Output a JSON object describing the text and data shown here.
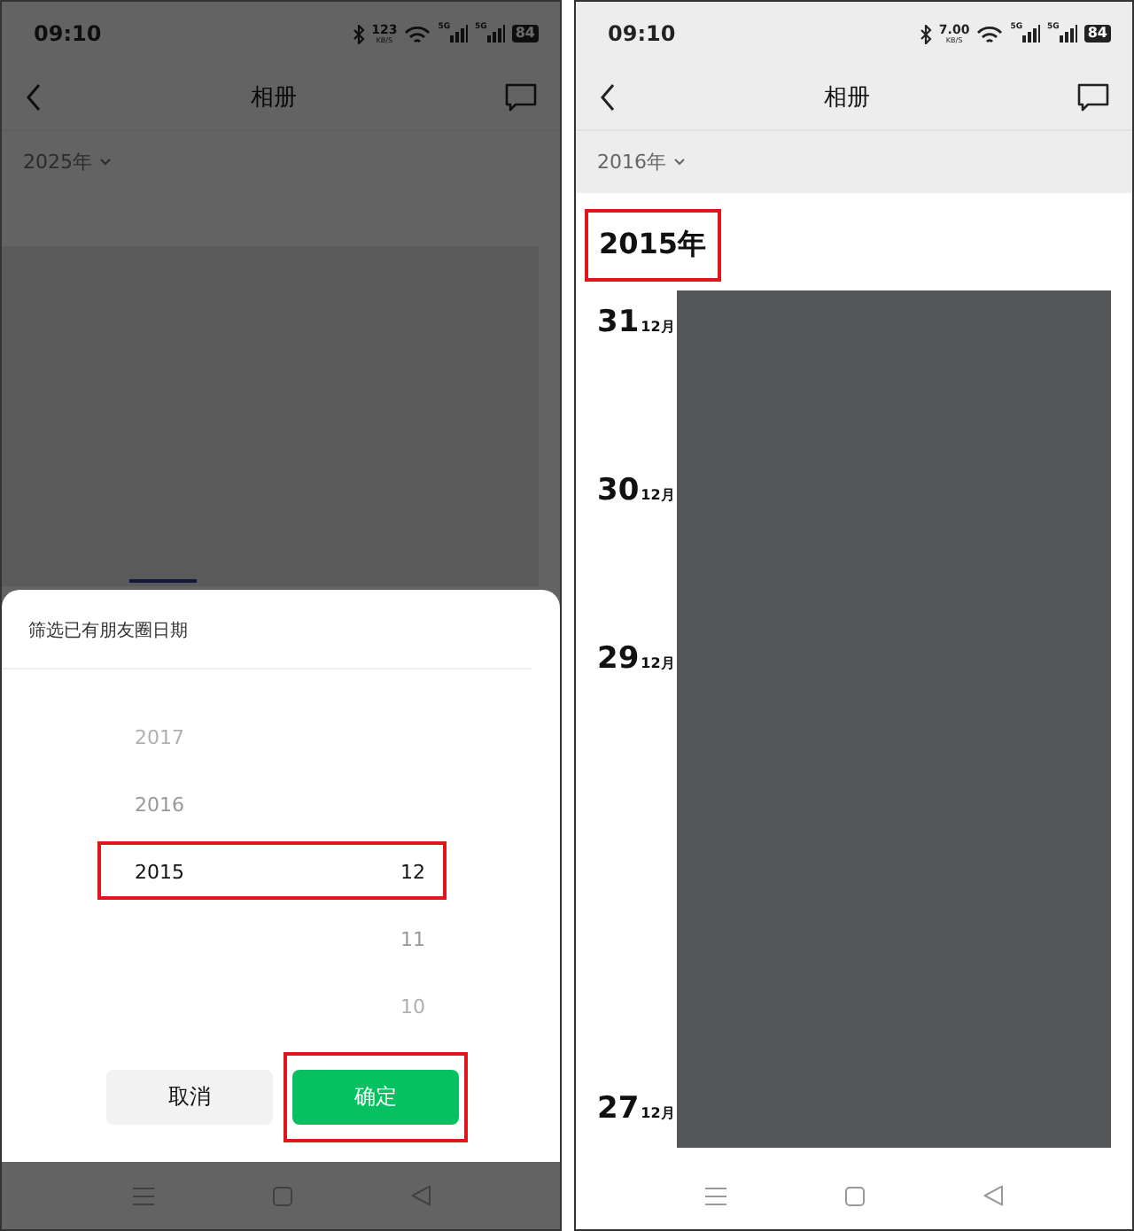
{
  "screens": [
    {
      "status_bar": {
        "time": "09:10",
        "speed": "123",
        "speed_unit": "KB/S",
        "signals": [
          "5G",
          "5G"
        ],
        "battery": "84"
      },
      "header": {
        "title": "相册"
      },
      "year_filter": {
        "label": "2025年"
      },
      "dimmed": true,
      "sheet": {
        "title": "筛选已有朋友圈日期",
        "years": [
          {
            "label": "2017",
            "selected": false
          },
          {
            "label": "2016",
            "selected": false
          },
          {
            "label": "2015",
            "selected": true
          }
        ],
        "months": [
          {
            "label": "12",
            "selected": true
          },
          {
            "label": "11",
            "selected": false
          },
          {
            "label": "10",
            "selected": false
          }
        ],
        "selection_highlighted": true,
        "buttons": [
          {
            "label": "取消",
            "kind": "cancel",
            "highlighted": false
          },
          {
            "label": "确定",
            "kind": "confirm",
            "highlighted": true
          }
        ]
      }
    },
    {
      "status_bar": {
        "time": "09:10",
        "speed": "7.00",
        "speed_unit": "KB/S",
        "signals": [
          "5G",
          "5G"
        ],
        "battery": "84"
      },
      "header": {
        "title": "相册"
      },
      "year_filter": {
        "label": "2016年"
      },
      "dimmed": false,
      "timeline": {
        "year": "2015年",
        "year_highlighted": true,
        "days": [
          {
            "day": "31",
            "month": "12月"
          },
          {
            "day": "30",
            "month": "12月"
          },
          {
            "day": "29",
            "month": "12月"
          },
          {
            "day": "27",
            "month": "12月"
          }
        ]
      }
    }
  ]
}
